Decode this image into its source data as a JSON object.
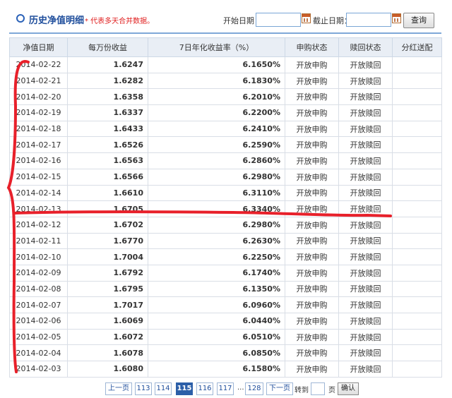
{
  "header": {
    "title": "历史净值明细",
    "note": "* 代表多天合并数据。",
    "start_label": "开始日期：",
    "end_label": "截止日期：",
    "query_label": "查询"
  },
  "table": {
    "columns": [
      "净值日期",
      "每万份收益",
      "7日年化收益率（%）",
      "申购状态",
      "赎回状态",
      "分红送配"
    ],
    "rows": [
      [
        "2014-02-22",
        "1.6247",
        "6.1650%",
        "开放申购",
        "开放赎回",
        ""
      ],
      [
        "2014-02-21",
        "1.6282",
        "6.1830%",
        "开放申购",
        "开放赎回",
        ""
      ],
      [
        "2014-02-20",
        "1.6358",
        "6.2010%",
        "开放申购",
        "开放赎回",
        ""
      ],
      [
        "2014-02-19",
        "1.6337",
        "6.2200%",
        "开放申购",
        "开放赎回",
        ""
      ],
      [
        "2014-02-18",
        "1.6433",
        "6.2410%",
        "开放申购",
        "开放赎回",
        ""
      ],
      [
        "2014-02-17",
        "1.6526",
        "6.2590%",
        "开放申购",
        "开放赎回",
        ""
      ],
      [
        "2014-02-16",
        "1.6563",
        "6.2860%",
        "开放申购",
        "开放赎回",
        ""
      ],
      [
        "2014-02-15",
        "1.6566",
        "6.2980%",
        "开放申购",
        "开放赎回",
        ""
      ],
      [
        "2014-02-14",
        "1.6610",
        "6.3110%",
        "开放申购",
        "开放赎回",
        ""
      ],
      [
        "2014-02-13",
        "1.6705",
        "6.3340%",
        "开放申购",
        "开放赎回",
        ""
      ],
      [
        "2014-02-12",
        "1.6702",
        "6.2980%",
        "开放申购",
        "开放赎回",
        ""
      ],
      [
        "2014-02-11",
        "1.6770",
        "6.2630%",
        "开放申购",
        "开放赎回",
        ""
      ],
      [
        "2014-02-10",
        "1.7004",
        "6.2250%",
        "开放申购",
        "开放赎回",
        ""
      ],
      [
        "2014-02-09",
        "1.6792",
        "6.1740%",
        "开放申购",
        "开放赎回",
        ""
      ],
      [
        "2014-02-08",
        "1.6795",
        "6.1350%",
        "开放申购",
        "开放赎回",
        ""
      ],
      [
        "2014-02-07",
        "1.7017",
        "6.0960%",
        "开放申购",
        "开放赎回",
        ""
      ],
      [
        "2014-02-06",
        "1.6069",
        "6.0440%",
        "开放申购",
        "开放赎回",
        ""
      ],
      [
        "2014-02-05",
        "1.6072",
        "6.0510%",
        "开放申购",
        "开放赎回",
        ""
      ],
      [
        "2014-02-04",
        "1.6078",
        "6.0850%",
        "开放申购",
        "开放赎回",
        ""
      ],
      [
        "2014-02-03",
        "1.6080",
        "6.1580%",
        "开放申购",
        "开放赎回",
        ""
      ]
    ]
  },
  "pager": {
    "prev": "上一页",
    "pages": [
      "113",
      "114",
      "115",
      "116",
      "117"
    ],
    "current": "115",
    "ellipsis": "...",
    "last": "128",
    "next": "下一页",
    "goto_label": "转到",
    "page_unit": "页",
    "confirm": "确认"
  },
  "colors": {
    "annotation": "#e8202a",
    "accent": "#2c5fa8"
  }
}
